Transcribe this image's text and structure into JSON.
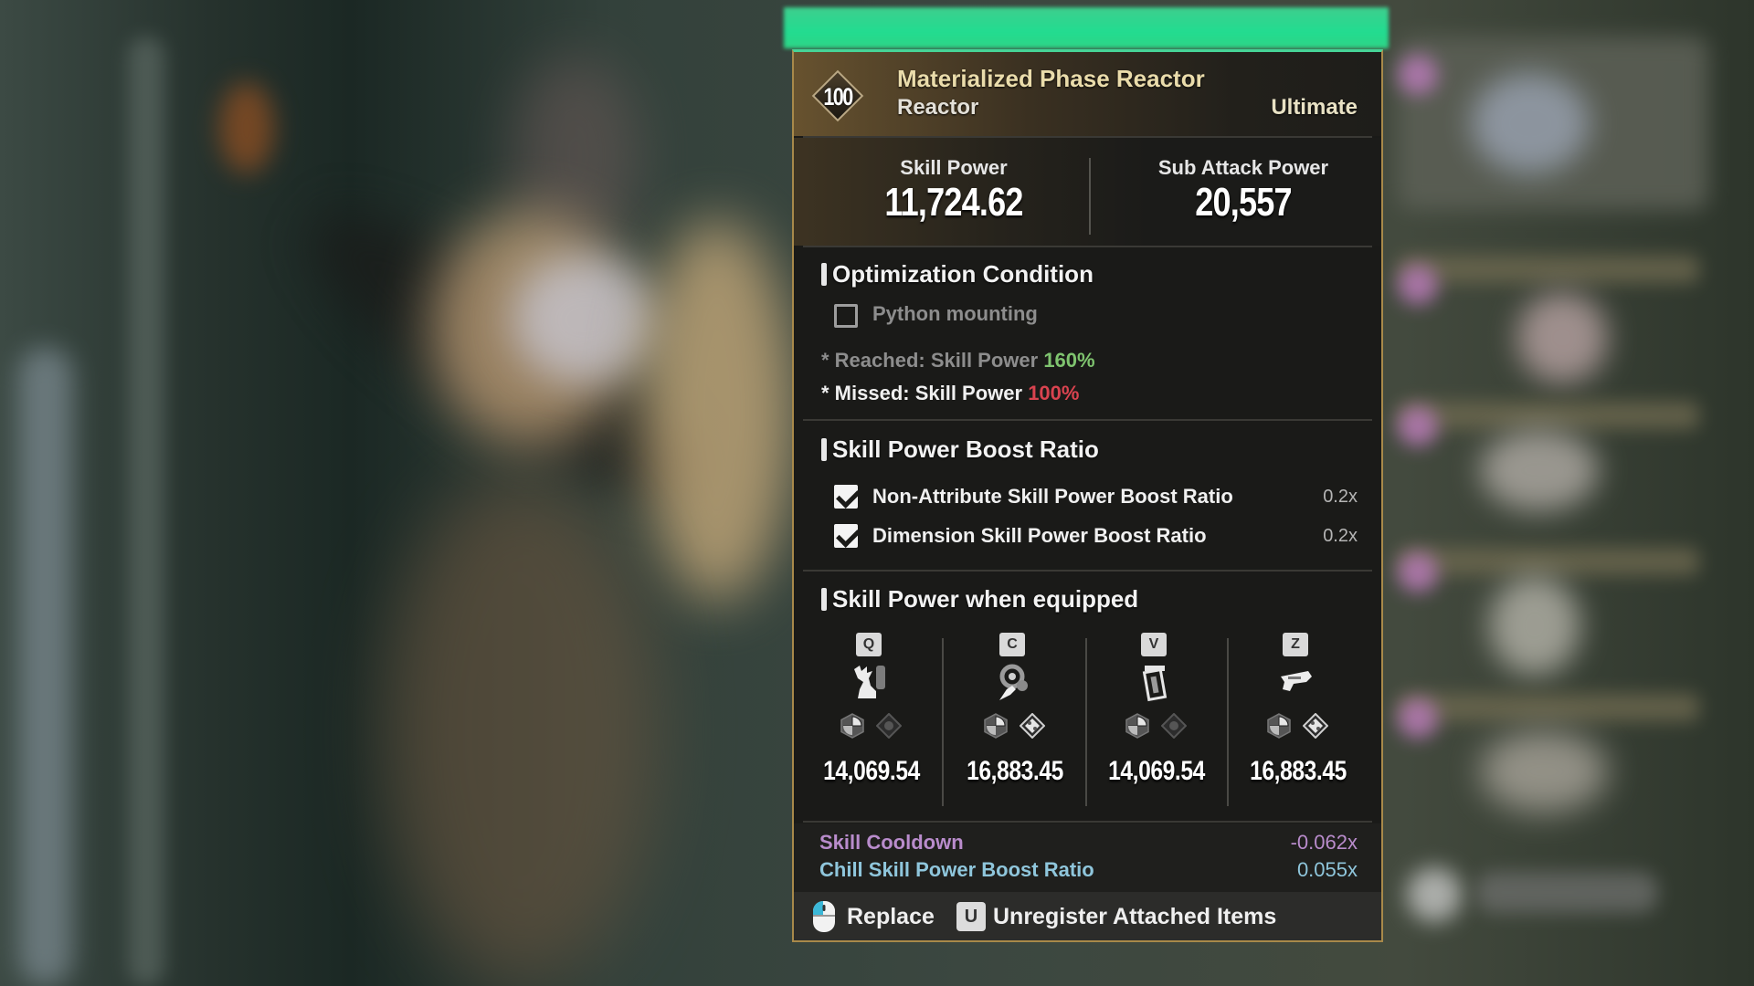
{
  "item": {
    "level": "100",
    "name": "Materialized Phase Reactor",
    "type": "Reactor",
    "tier": "Ultimate"
  },
  "stats": {
    "skill_power_label": "Skill Power",
    "skill_power_value": "11,724.62",
    "sub_attack_label": "Sub Attack Power",
    "sub_attack_value": "20,557"
  },
  "optimization": {
    "title": "Optimization Condition",
    "condition_label": "Python mounting",
    "condition_checked": false,
    "reached_prefix": "* Reached: Skill Power ",
    "reached_value": "160%",
    "missed_prefix": "* Missed: Skill Power ",
    "missed_value": "100%"
  },
  "boost_ratio": {
    "title": "Skill Power Boost Ratio",
    "items": [
      {
        "label": "Non-Attribute Skill Power Boost Ratio",
        "value": "0.2x",
        "checked": true
      },
      {
        "label": "Dimension Skill Power Boost Ratio",
        "value": "0.2x",
        "checked": true
      }
    ]
  },
  "equipped": {
    "title": "Skill Power when equipped",
    "slots": [
      {
        "key": "Q",
        "skill_icon": "claw-strike-icon",
        "rune_b": "inactive",
        "power": "14,069.54"
      },
      {
        "key": "C",
        "skill_icon": "hand-vortex-icon",
        "rune_b": "active",
        "power": "16,883.45"
      },
      {
        "key": "V",
        "skill_icon": "pillar-icon",
        "rune_b": "inactive",
        "power": "14,069.54"
      },
      {
        "key": "Z",
        "skill_icon": "gun-icon",
        "rune_b": "active",
        "power": "16,883.45"
      }
    ]
  },
  "sub_stats": [
    {
      "label": "Skill Cooldown",
      "value": "-0.062x",
      "color": "#b98ccc"
    },
    {
      "label": "Chill Skill Power Boost Ratio",
      "value": "0.055x",
      "color": "#8fc6dc"
    }
  ],
  "colors": {
    "reached": "#7fc46f",
    "missed": "#d9434f",
    "rarity_bar": "#22dc90",
    "border": "#a8894a"
  },
  "footer": {
    "replace_label": "Replace",
    "unregister_key": "U",
    "unregister_label": "Unregister Attached Items"
  }
}
